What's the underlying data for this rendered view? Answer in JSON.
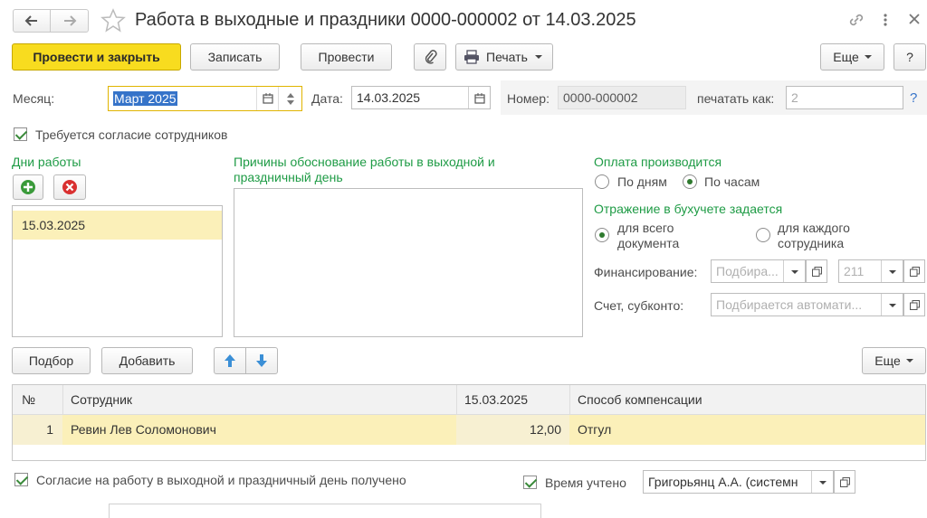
{
  "window": {
    "title": "Работа в выходные и праздники 0000-000002 от 14.03.2025"
  },
  "toolbar": {
    "post_close": "Провести и закрыть",
    "save": "Записать",
    "post": "Провести",
    "print": "Печать",
    "more": "Еще",
    "help": "?"
  },
  "fields": {
    "month_label": "Месяц:",
    "month_value": "Март 2025",
    "date_label": "Дата:",
    "date_value": "14.03.2025",
    "number_label": "Номер:",
    "number_value": "0000-000002",
    "print_as_label": "печатать как:",
    "print_as_placeholder": "2",
    "help_link": "?"
  },
  "consent_required": {
    "label": "Требуется согласие сотрудников",
    "checked": true
  },
  "work_days": {
    "title": "Дни работы",
    "items": [
      "15.03.2025"
    ]
  },
  "reasons": {
    "title_line1": "Причины обоснование работы в выходной и",
    "title_line2": "праздничный день",
    "value": ""
  },
  "payment": {
    "title": "Оплата производится",
    "options": [
      "По дням",
      "По часам"
    ],
    "selected": "По часам"
  },
  "accounting": {
    "title": "Отражение в бухучете задается",
    "option1_line1": "для всего",
    "option1_line2": "документа",
    "option2_line1": "для каждого",
    "option2_line2": "сотрудника",
    "selected": "для всего документа",
    "financing_label": "Финансирование:",
    "financing_placeholder": "Подбира...",
    "financing_code": "211",
    "account_label": "Счет, субконто:",
    "account_placeholder": "Подбирается автомати..."
  },
  "table_toolbar": {
    "select": "Подбор",
    "add": "Добавить",
    "more": "Еще"
  },
  "table": {
    "headers": [
      "№",
      "Сотрудник",
      "15.03.2025",
      "Способ компенсации"
    ],
    "rows": [
      {
        "num": "1",
        "employee": "Ревин Лев Соломонович",
        "hours": "12,00",
        "compensation": "Отгул"
      }
    ]
  },
  "footer": {
    "consent_received": "Согласие на работу в выходной и праздничный день получено",
    "time_accounted": "Время учтено",
    "responsible": "Григорьянц А.А. (системн"
  },
  "colors": {
    "accent_yellow": "#f8dc1f",
    "selected_row": "#fbf0b9",
    "section_green": "#1e9b45"
  }
}
